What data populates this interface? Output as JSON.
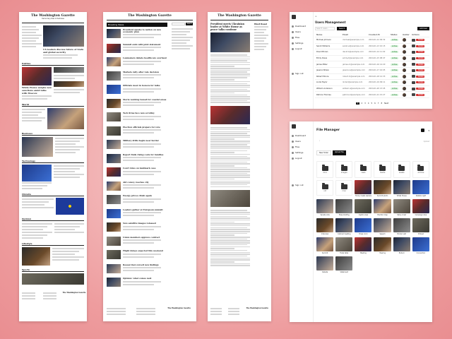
{
  "colors": {
    "background": "#ee9c9e",
    "accent": "#111111",
    "status_green": "#d9f2dc",
    "danger": "#d32f2f"
  },
  "newspaper": {
    "masthead": "The Washington Gazette",
    "tagline": "Democracy Dies in Darkness",
    "nav": [
      "Politics",
      "World",
      "Business",
      "Tech",
      "Opinion",
      "Sports",
      "Style",
      "Climate"
    ],
    "lead_headline": "US leaders discuss future of trade and global security",
    "second_headline": "White House weighs new sanctions amid talks with Moscow",
    "sections": [
      "Politics",
      "World",
      "Business",
      "Technology",
      "Climate",
      "Opinion",
      "Lifestyle",
      "Sports"
    ],
    "footer_logo": "The Washington Gazette"
  },
  "listing": {
    "masthead": "The Washington Gazette",
    "section_title": "Breaking News",
    "search_label": "Search",
    "items": [
      "President speaks to nation on new economic plan",
      "Summit ends with joint statement",
      "Lawmakers debate healthcare overhaul",
      "Markets rally after rate decision",
      "Officials meet in Geneva for talks",
      "Storm warning issued for coastal areas",
      "Tech firms face new scrutiny",
      "Election officials prepare for vote",
      "Military drills begin near border",
      "Report finds rising costs for families",
      "Court rules on landmark case",
      "Aid convoy reaches city",
      "Energy prices climb again",
      "Leaders gather at European summit",
      "New satellite images released",
      "Union members approve contract",
      "Flight delays expected this weekend",
      "Researchers unveil new findings",
      "Opinion: what comes next"
    ]
  },
  "article": {
    "masthead": "The Washington Gazette",
    "headline": "President meets Ukrainian leader at White House as peace talks continue",
    "related_title": "Most Read"
  },
  "users": {
    "title": "Users Management",
    "search_placeholder": "Search users...",
    "search_button": "Search",
    "add_button": "Add User",
    "nav": [
      "Dashboard",
      "Users",
      "Files",
      "Settings",
      "Logout"
    ],
    "footer_nav": "Sign out",
    "columns": [
      "Name",
      "Email",
      "Created At",
      "Status",
      "Avatar",
      "Actions"
    ],
    "rows": [
      {
        "name": "Michael Johnson",
        "email": "michael@example.com",
        "date": "2024-01-12 09:32",
        "status": "Active"
      },
      {
        "name": "Sarah Williams",
        "email": "sarah.w@example.com",
        "date": "2024-01-13 10:15",
        "status": "Active"
      },
      {
        "name": "David Brown",
        "email": "david.b@example.com",
        "date": "2024-01-14 11:02",
        "status": "Active"
      },
      {
        "name": "Emily Davis",
        "email": "emily.d@example.com",
        "date": "2024-01-15 08:47",
        "status": "Active"
      },
      {
        "name": "James Miller",
        "email": "james.m@example.com",
        "date": "2024-01-16 14:20",
        "status": "Active"
      },
      {
        "name": "Jessica Wilson",
        "email": "jessica.w@example.com",
        "date": "2024-01-17 16:05",
        "status": "Active"
      },
      {
        "name": "Robert Moore",
        "email": "robert.m@example.com",
        "date": "2024-01-18 12:33",
        "status": "Active"
      },
      {
        "name": "Linda Taylor",
        "email": "linda.t@example.com",
        "date": "2024-01-19 09:11",
        "status": "Active"
      },
      {
        "name": "William Anderson",
        "email": "william.a@example.com",
        "date": "2024-01-20 13:45",
        "status": "Active"
      },
      {
        "name": "Patricia Thomas",
        "email": "patricia.t@example.com",
        "date": "2024-01-21 15:27",
        "status": "Active"
      }
    ],
    "delete_label": "Delete",
    "pagination": [
      "1",
      "2",
      "3",
      "4",
      "5",
      "6",
      "7",
      "8"
    ],
    "next_label": "Next"
  },
  "files": {
    "title": "File Manager",
    "nav": [
      "Dashboard",
      "Users",
      "Files",
      "Settings",
      "Logout"
    ],
    "footer_nav": "Sign out",
    "path_placeholder": "/",
    "upload_label": "Upload",
    "tabs": [
      "New folder",
      "Upload file"
    ],
    "folders": [
      "docs",
      "images",
      "news",
      "media",
      "assets",
      "archive",
      "old",
      "misc"
    ],
    "captions": [
      "Trump meets leaders",
      "Summit photo",
      "White House",
      "Debate night",
      "Senate vote",
      "Press briefing",
      "Capitol view",
      "Election map",
      "Rally crowd",
      "Campaign stop",
      "Interview",
      "Cabinet meeting",
      "Press room",
      "Speech",
      "Border visit",
      "Protest",
      "Summit",
      "Trade talks",
      "Meeting",
      "Hearing",
      "Podium",
      "Convention",
      "Debate",
      "Statement"
    ]
  }
}
